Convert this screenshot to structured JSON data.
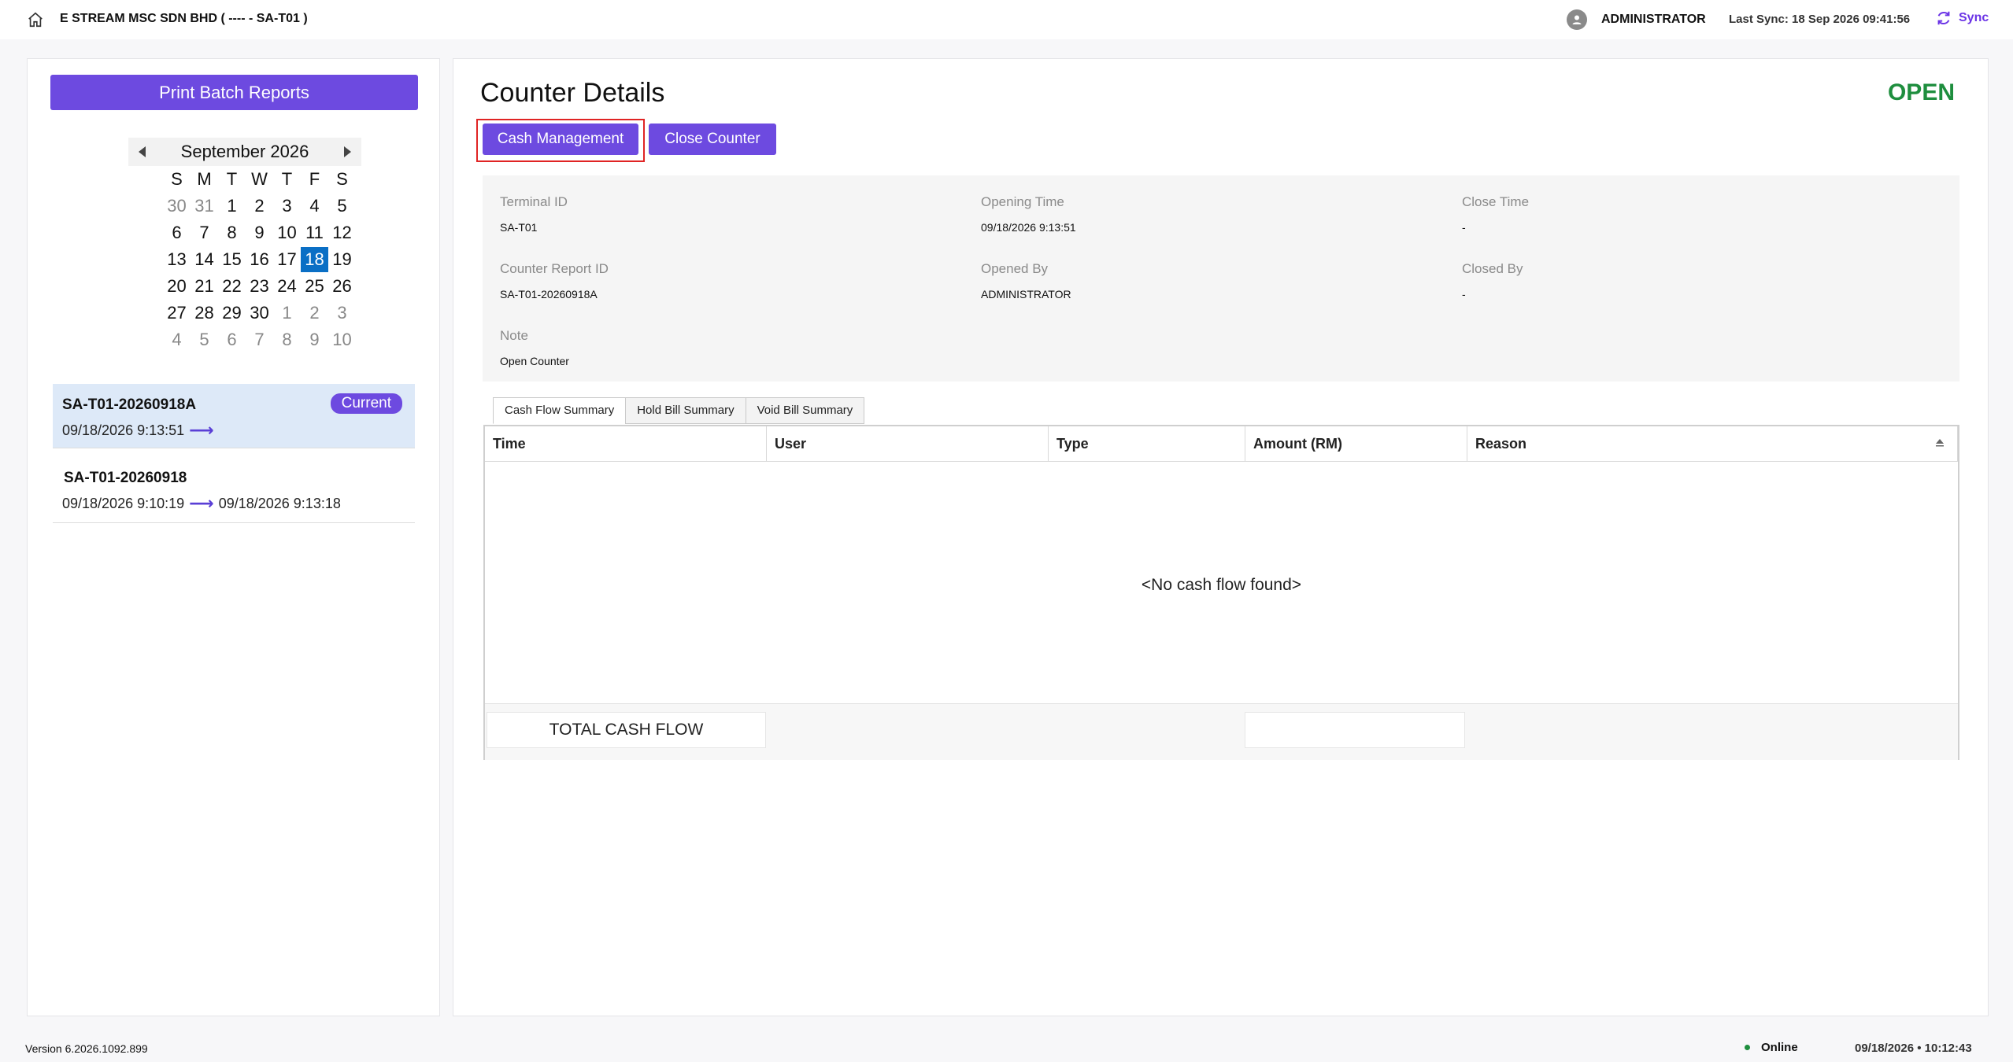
{
  "header": {
    "company": "E STREAM MSC SDN BHD ( ---- - SA-T01 )",
    "user": "ADMINISTRATOR",
    "last_sync": "Last Sync: 18 Sep 2026 09:41:56",
    "sync_label": "Sync",
    "icons": {
      "home": "home-icon",
      "user": "user-avatar-icon",
      "sync": "sync-icon"
    },
    "accent_color": "#6b34e6"
  },
  "sidebar": {
    "print_button": "Print Batch Reports",
    "calendar": {
      "title": "September 2026",
      "days_of_week": [
        "S",
        "M",
        "T",
        "W",
        "T",
        "F",
        "S"
      ],
      "weeks": [
        [
          "30",
          "31",
          "1",
          "2",
          "3",
          "4",
          "5"
        ],
        [
          "6",
          "7",
          "8",
          "9",
          "10",
          "11",
          "12"
        ],
        [
          "13",
          "14",
          "15",
          "16",
          "17",
          "18",
          "19"
        ],
        [
          "20",
          "21",
          "22",
          "23",
          "24",
          "25",
          "26"
        ],
        [
          "27",
          "28",
          "29",
          "30",
          "1",
          "2",
          "3"
        ],
        [
          "4",
          "5",
          "6",
          "7",
          "8",
          "9",
          "10"
        ]
      ],
      "selected": "18",
      "selected_color": "#0a6fc5"
    },
    "reports": [
      {
        "id": "SA-T01-20260918A",
        "badge": "Current",
        "start": "09/18/2026 9:13:51",
        "end": ""
      },
      {
        "id": "SA-T01-20260918",
        "badge": "",
        "start": "09/18/2026 9:10:19",
        "end": "09/18/2026 9:13:18"
      }
    ]
  },
  "main": {
    "title": "Counter Details",
    "status": "OPEN",
    "status_color": "#1e8e3e",
    "buttons": {
      "cash_management": "Cash Management",
      "close_counter": "Close Counter"
    },
    "info": {
      "terminal_id_label": "Terminal ID",
      "terminal_id": "SA-T01",
      "opening_time_label": "Opening Time",
      "opening_time": "09/18/2026 9:13:51",
      "close_time_label": "Close Time",
      "close_time": "-",
      "counter_report_id_label": "Counter Report ID",
      "counter_report_id": "SA-T01-20260918A",
      "opened_by_label": "Opened By",
      "opened_by": "ADMINISTRATOR",
      "closed_by_label": "Closed By",
      "closed_by": "-",
      "note_label": "Note",
      "note": "Open Counter"
    },
    "tabs": [
      "Cash Flow Summary",
      "Hold Bill Summary",
      "Void Bill Summary"
    ],
    "active_tab": "Cash Flow Summary",
    "grid": {
      "columns": [
        "Time",
        "User",
        "Type",
        "Amount (RM)",
        "Reason"
      ],
      "empty_message": "<No cash flow found>",
      "total_label": "TOTAL CASH FLOW",
      "total_amount": ""
    }
  },
  "footer": {
    "version": "Version 6.2026.1092.899",
    "connection": "Online",
    "clock": "09/18/2026  •  10:12:43"
  }
}
